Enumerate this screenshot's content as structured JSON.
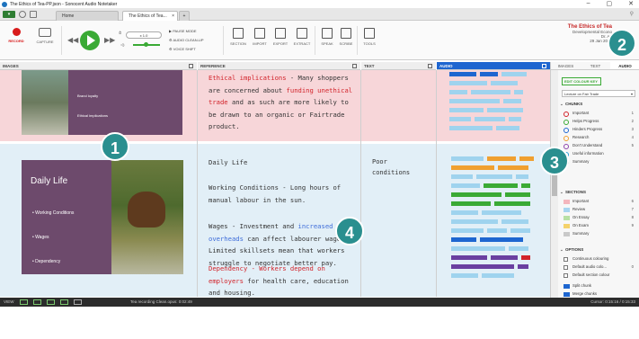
{
  "window": {
    "title": "The Ethics of Tea-PP.json - Sonocent Audio Notetaker",
    "controls": [
      "–",
      "▢",
      "✕"
    ]
  },
  "tabs": [
    {
      "label": "Home"
    },
    {
      "label": "The Ethics of Tea..."
    }
  ],
  "ribbon": {
    "record_label": "RECORD",
    "capture_label": "CAPTURE",
    "speed_value": "x 1.0",
    "pause_mode": "PAUSE MODE",
    "audio_clean_up": "AUDIO CLEAN-UP",
    "voice_shift": "VOICE SHIFT",
    "section": "SECTION",
    "import": "IMPORT",
    "export": "EXPORT",
    "extract": "EXTRACT",
    "speak": "SPEAK",
    "scribe": "SCRIBE",
    "tools": "TOOLS"
  },
  "brand": {
    "title": "The Ethics of Tea",
    "line2": "Developmental Econo",
    "line3": "Dr. Au",
    "date": "29 Jan 2017"
  },
  "columns": {
    "images": "IMAGES",
    "reference": "REFERENCE",
    "text": "TEXT",
    "audio": "AUDIO"
  },
  "slide_top": {
    "bullets": [
      "Brand loyalty",
      "Ethical implications"
    ]
  },
  "slide_main": {
    "title": "Daily Life",
    "bullets": [
      "Working Conditions",
      "Wages",
      "Dependency"
    ]
  },
  "reference": {
    "row1": {
      "p1_red": "Ethical implications",
      "p1_rest": " - Many shoppers are concerned about ",
      "p1_red2": "funding unethical trade",
      "p1_end": " and as such are more likely to be drawn to an organic or Fairtrade product."
    },
    "row2": {
      "heading": "Daily Life",
      "wc": "Working Conditions - Long hours of manual labour in the sun.",
      "wages_a": "Wages - Investment and ",
      "wages_blue": "increased overheads",
      "wages_b": " can affect labourer wages. Limited skillsets mean that workers struggle to negotiate better pay.",
      "dep_red": "Dependency - Workers depend on employers",
      "dep_rest": " for health care, education and housing."
    }
  },
  "text_col": {
    "row2": "Poor conditions"
  },
  "sidebar": {
    "tabs": [
      "IMAGES",
      "TEXT",
      "AUDIO"
    ],
    "edit_colour_key": "EDIT COLOUR KEY",
    "selector": "Lecture on Fair Trade",
    "chunks_head": "CHUNKS",
    "chunks": [
      {
        "label": "Important",
        "count": "1",
        "color": "#d2232a"
      },
      {
        "label": "Helps Progress",
        "count": "2",
        "color": "#3aaa35"
      },
      {
        "label": "Hinders Progress",
        "count": "3",
        "color": "#1e66d0"
      },
      {
        "label": "Research",
        "count": "4",
        "color": "#f0a030"
      },
      {
        "label": "Don't Understand",
        "count": "5",
        "color": "#8e44ad"
      },
      {
        "label": "Useful information",
        "count": "",
        "color": "#2a9fd6"
      },
      {
        "label": "Summary",
        "count": "",
        "color": "#999999"
      }
    ],
    "sections_head": "SECTIONS",
    "sections": [
      {
        "label": "Important",
        "count": "6",
        "color": "#f4b6bd"
      },
      {
        "label": "Review",
        "count": "7",
        "color": "#a8d5f0"
      },
      {
        "label": "On Essay",
        "count": "8",
        "color": "#b7e0a4"
      },
      {
        "label": "On Exam",
        "count": "9",
        "color": "#f4d26b"
      },
      {
        "label": "Summary",
        "count": "",
        "color": "#c9c9c9"
      }
    ],
    "options_head": "OPTIONS",
    "options": [
      {
        "label": "Continuous colouring",
        "count": ""
      },
      {
        "label": "Default audio colo...",
        "count": "0"
      },
      {
        "label": "Default section colour",
        "count": ""
      }
    ],
    "split_chunk": "Split chunk",
    "merge_chunks": "Merge chunks"
  },
  "statusbar": {
    "view": "VIEW",
    "file": "Tea recording Clean.opus: 0:02:49",
    "cursor": "Cursor: 0:15:16 / 0:15:33"
  },
  "callouts": [
    "1",
    "2",
    "3",
    "4"
  ],
  "chart_colors": {
    "light_blue": "#9fd3ee",
    "blue": "#1e66d0",
    "orange": "#f0a030",
    "green": "#3aaa35",
    "purple": "#6a3fa0",
    "red": "#d2232a"
  }
}
